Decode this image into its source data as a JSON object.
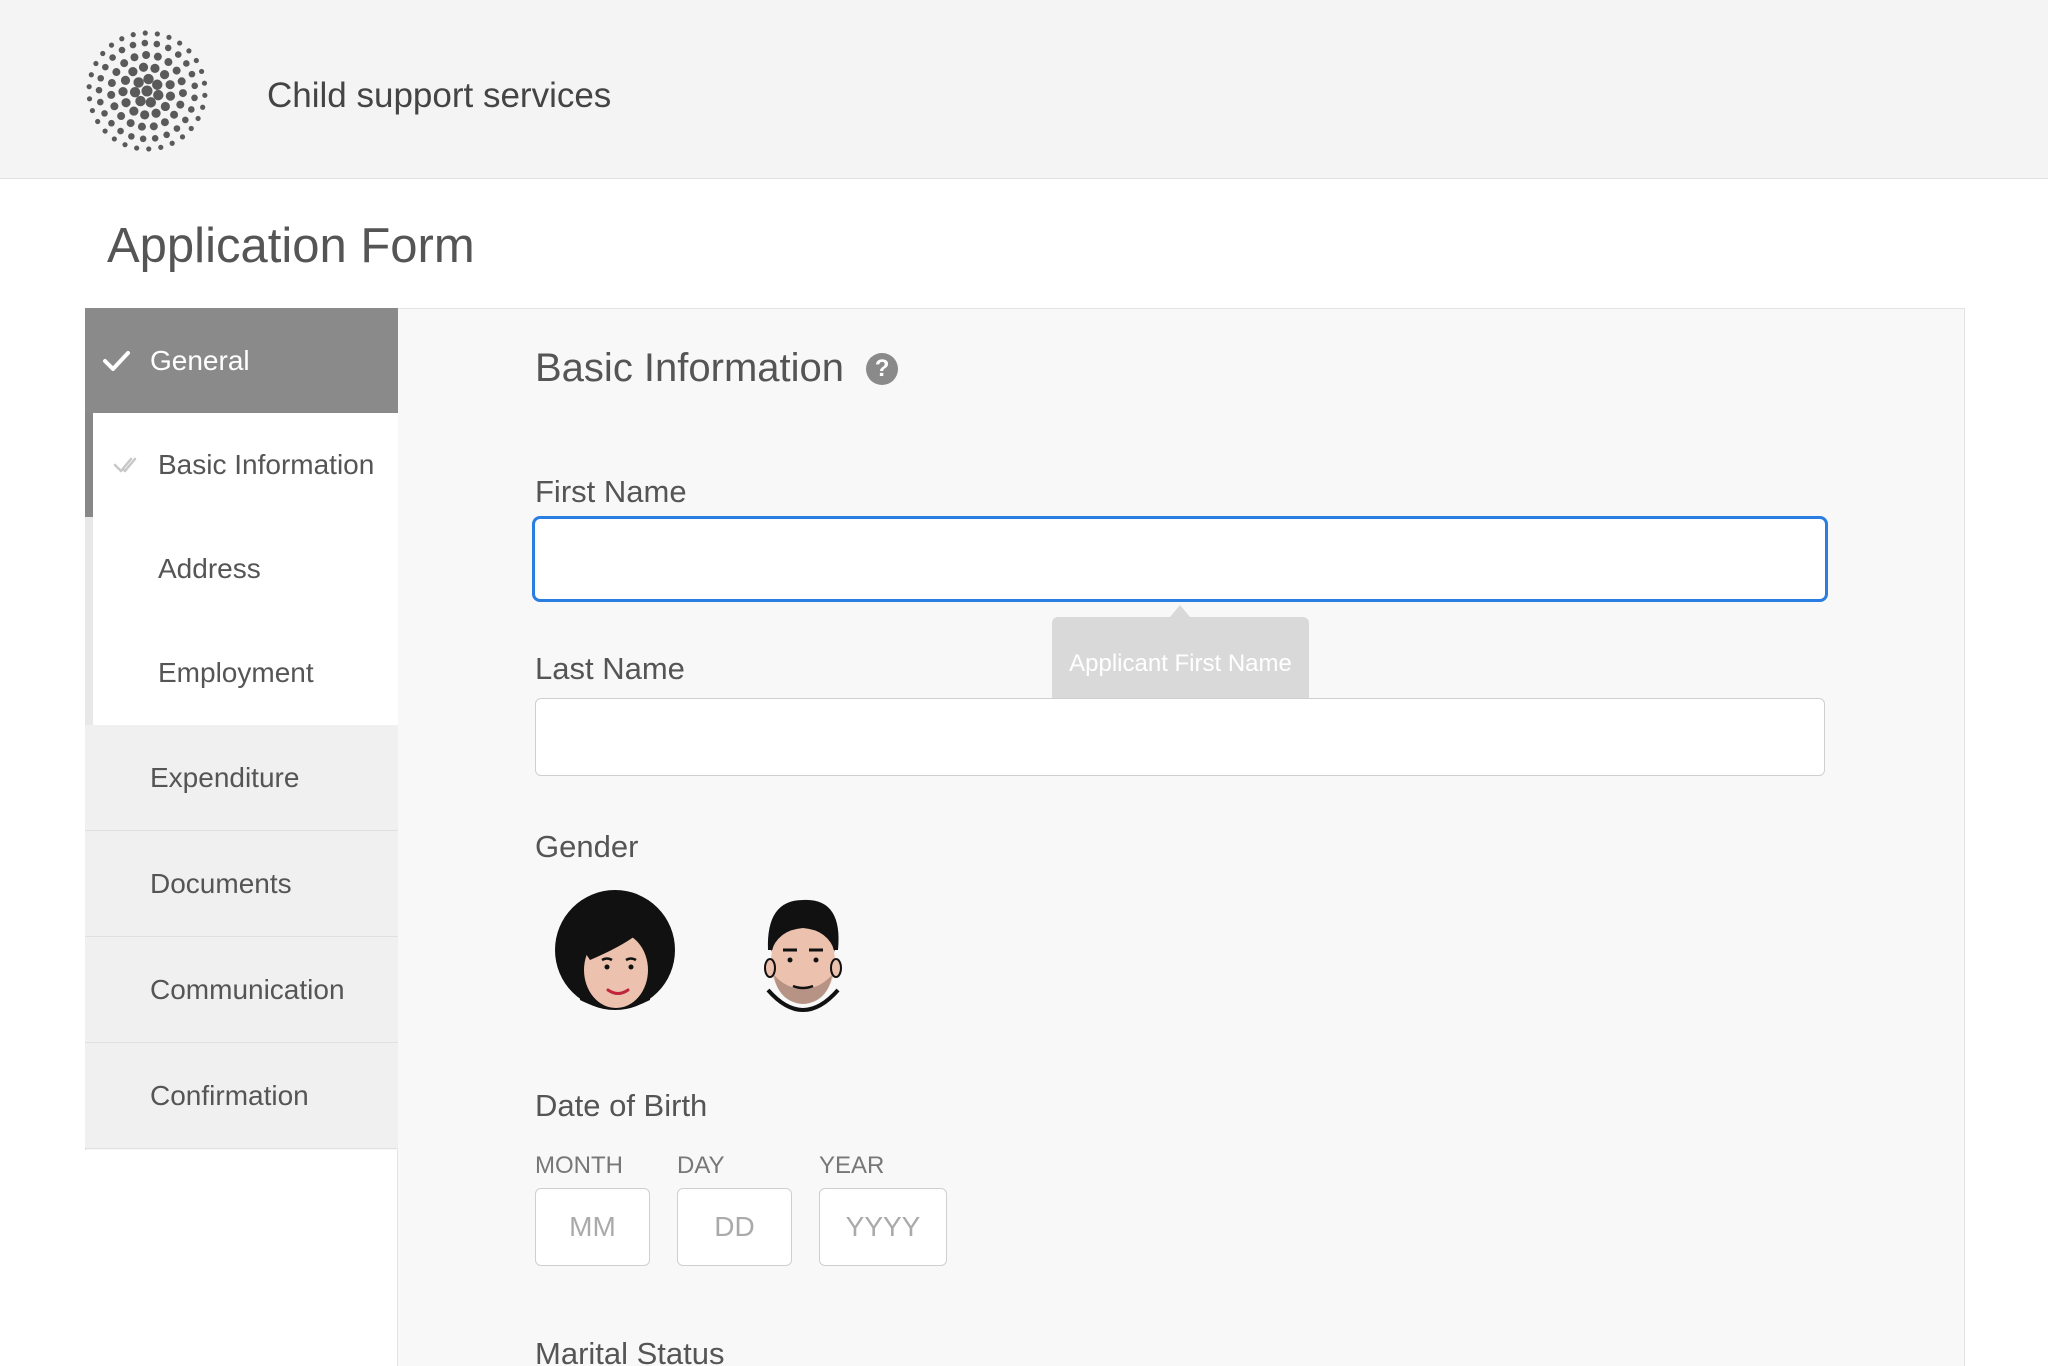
{
  "header": {
    "app_title": "Child support services",
    "logo_icon": "dotted-sphere-logo"
  },
  "page": {
    "title": "Application Form"
  },
  "sidebar": {
    "items": [
      {
        "label": "General",
        "state": "active",
        "icon": "check-icon"
      },
      {
        "label": "Expenditure"
      },
      {
        "label": "Documents"
      },
      {
        "label": "Communication"
      },
      {
        "label": "Confirmation"
      }
    ],
    "subitems": [
      {
        "label": "Basic Information",
        "state": "current",
        "icon": "double-check-icon"
      },
      {
        "label": "Address"
      },
      {
        "label": "Employment"
      }
    ]
  },
  "form": {
    "section_title": "Basic Information",
    "help_icon_glyph": "?",
    "first_name": {
      "label": "First Name",
      "value": "",
      "tooltip": "Applicant First Name"
    },
    "last_name": {
      "label": "Last Name",
      "value": ""
    },
    "gender": {
      "label": "Gender",
      "options": [
        "female-avatar-icon",
        "male-avatar-icon"
      ]
    },
    "dob": {
      "label": "Date of Birth",
      "month": {
        "label": "MONTH",
        "placeholder": "MM"
      },
      "day": {
        "label": "DAY",
        "placeholder": "DD"
      },
      "year": {
        "label": "YEAR",
        "placeholder": "YYYY"
      }
    },
    "marital_status": {
      "label": "Marital Status"
    }
  },
  "colors": {
    "accent_focus": "#2a7de1",
    "active_nav": "#8a8a8a",
    "header_bg": "#f4f4f4"
  }
}
